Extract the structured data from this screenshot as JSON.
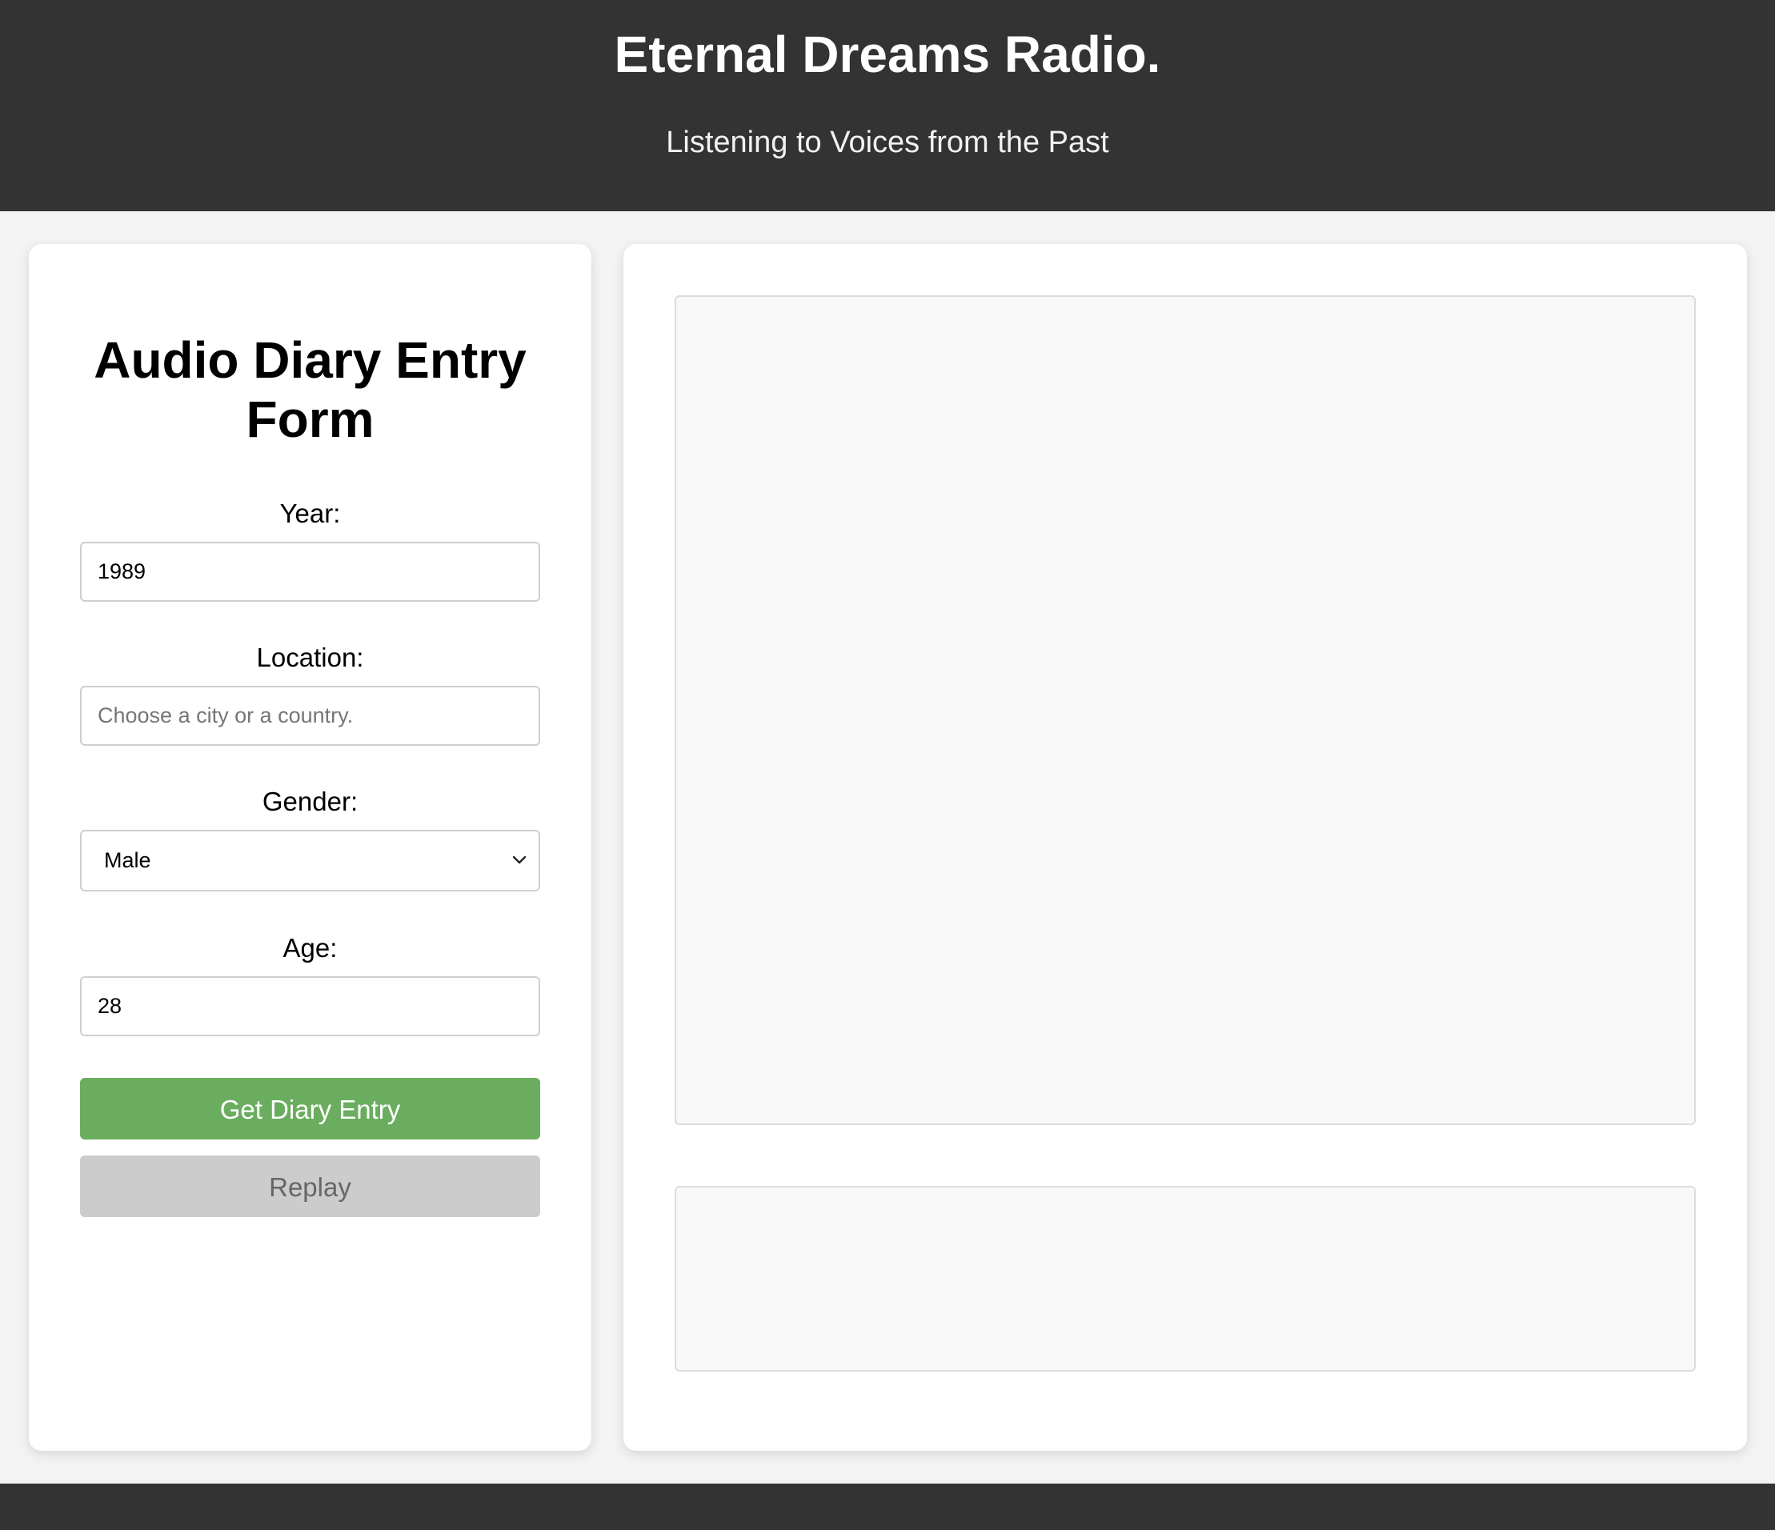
{
  "header": {
    "title": "Eternal Dreams Radio.",
    "subtitle": "Listening to Voices from the Past"
  },
  "form": {
    "title": "Audio Diary Entry Form",
    "year": {
      "label": "Year:",
      "value": "1989"
    },
    "location": {
      "label": "Location:",
      "value": "",
      "placeholder": "Choose a city or a country."
    },
    "gender": {
      "label": "Gender:",
      "selected": "Male",
      "icon": "chevron-down-icon"
    },
    "age": {
      "label": "Age:",
      "value": "28"
    },
    "submit_label": "Get Diary Entry",
    "replay_label": "Replay"
  },
  "colors": {
    "header_bg": "#333333",
    "page_bg": "#f3f3f3",
    "primary_button": "#6aad5e",
    "disabled_button": "#cccccc"
  }
}
